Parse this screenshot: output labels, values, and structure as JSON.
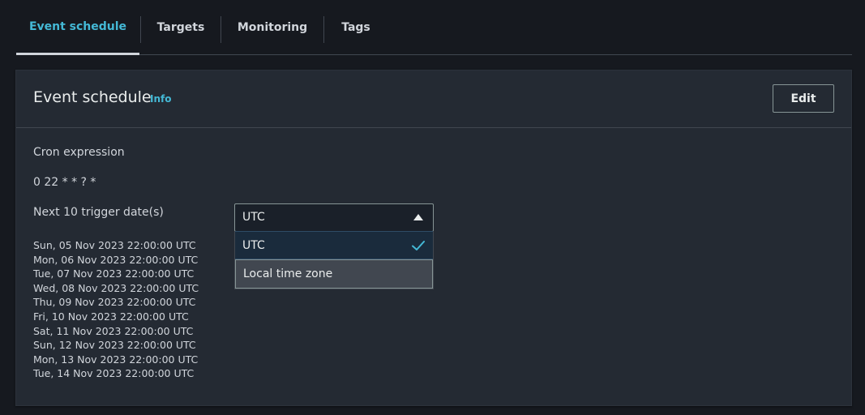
{
  "tabs": [
    {
      "label": "Event schedule",
      "active": true
    },
    {
      "label": "Targets",
      "active": false
    },
    {
      "label": "Monitoring",
      "active": false
    },
    {
      "label": "Tags",
      "active": false
    }
  ],
  "panel": {
    "title": "Event schedule",
    "info_label": "Info",
    "edit_label": "Edit"
  },
  "cron": {
    "label": "Cron expression",
    "value": "0 22 * * ? *"
  },
  "triggers": {
    "label": "Next 10 trigger date(s)",
    "dates": [
      "Sun, 05 Nov 2023 22:00:00 UTC",
      "Mon, 06 Nov 2023 22:00:00 UTC",
      "Tue, 07 Nov 2023 22:00:00 UTC",
      "Wed, 08 Nov 2023 22:00:00 UTC",
      "Thu, 09 Nov 2023 22:00:00 UTC",
      "Fri, 10 Nov 2023 22:00:00 UTC",
      "Sat, 11 Nov 2023 22:00:00 UTC",
      "Sun, 12 Nov 2023 22:00:00 UTC",
      "Mon, 13 Nov 2023 22:00:00 UTC",
      "Tue, 14 Nov 2023 22:00:00 UTC"
    ]
  },
  "timezone_select": {
    "selected": "UTC",
    "options": [
      "UTC",
      "Local time zone"
    ]
  },
  "colors": {
    "accent": "#44b9d6",
    "background": "#16191f",
    "panel": "#242a33"
  },
  "icons": {
    "caret": "caret-up-icon",
    "check": "check-icon"
  }
}
